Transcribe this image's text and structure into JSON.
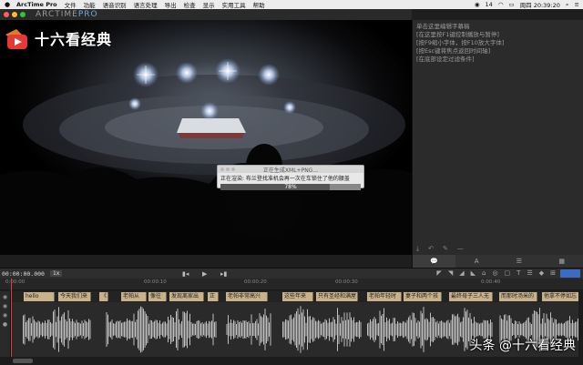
{
  "menubar": {
    "apple": "",
    "app_name": "ArcTime Pro",
    "items": [
      "文件",
      "功能",
      "语音识别",
      "语言处理",
      "导出",
      "检查",
      "显示",
      "实用工具",
      "帮助"
    ],
    "status": {
      "wechat_count": "14",
      "day_time": "周四 20:39:20"
    }
  },
  "titlebar": {
    "brand_main": "ARCTIME",
    "brand_pro": "PRO"
  },
  "video": {
    "logo_text": "十六看经典"
  },
  "dialog": {
    "title": "正在生成XML+PNG...",
    "status": "正在渲染: 布兰登找准机会再一次在车锁住了他的腰盖",
    "progress_label": "78%",
    "progress": 0.78
  },
  "side_panel": {
    "help_lines": [
      "单击这里编辑字幕稿",
      "[在这里按F1键控制播放与暂停]",
      "[按F9缩小字体，按F10放大字体]",
      "[按Esc键将焦点返回时间轴]",
      "[在底部设定过滤条件]"
    ],
    "tabs": [
      {
        "label": "💬",
        "active": true
      },
      {
        "label": "A",
        "active": false
      },
      {
        "label": "☰",
        "active": false
      },
      {
        "label": "▦",
        "active": false
      }
    ]
  },
  "transport": {
    "timecode": "00:00:00.000",
    "speed": "1x"
  },
  "ruler": {
    "labels": [
      {
        "text": "0:00:00",
        "pos": 6
      },
      {
        "text": "00:00:10",
        "pos": 158
      },
      {
        "text": "00:00:20",
        "pos": 268
      },
      {
        "text": "00:00:30",
        "pos": 368
      },
      {
        "text": "0:00:40",
        "pos": 528
      }
    ]
  },
  "subtitles": [
    {
      "text": "hello",
      "start": 14,
      "width": 34
    },
    {
      "text": "今天我们来",
      "start": 52,
      "width": 36
    },
    {
      "text": "《",
      "start": 97,
      "width": 10
    },
    {
      "text": "老帕从",
      "start": 121,
      "width": 28
    },
    {
      "text": "像往",
      "start": 151,
      "width": 20
    },
    {
      "text": "发现离家出",
      "start": 174,
      "width": 38
    },
    {
      "text": "正",
      "start": 216,
      "width": 12
    },
    {
      "text": "老帕非常高兴",
      "start": 236,
      "width": 46
    },
    {
      "text": "这些年来",
      "start": 298,
      "width": 34
    },
    {
      "text": "只有圣经和满屋",
      "start": 335,
      "width": 46
    },
    {
      "text": "老帕年轻时",
      "start": 391,
      "width": 38
    },
    {
      "text": "妻子和两个孩",
      "start": 431,
      "width": 42
    },
    {
      "text": "最终母子三人无",
      "start": 481,
      "width": 48
    },
    {
      "text": "而那时汤米的",
      "start": 536,
      "width": 42
    },
    {
      "text": "他拿不停如忘",
      "start": 583,
      "width": 44
    }
  ],
  "watermark": "头条 @十六看经典"
}
